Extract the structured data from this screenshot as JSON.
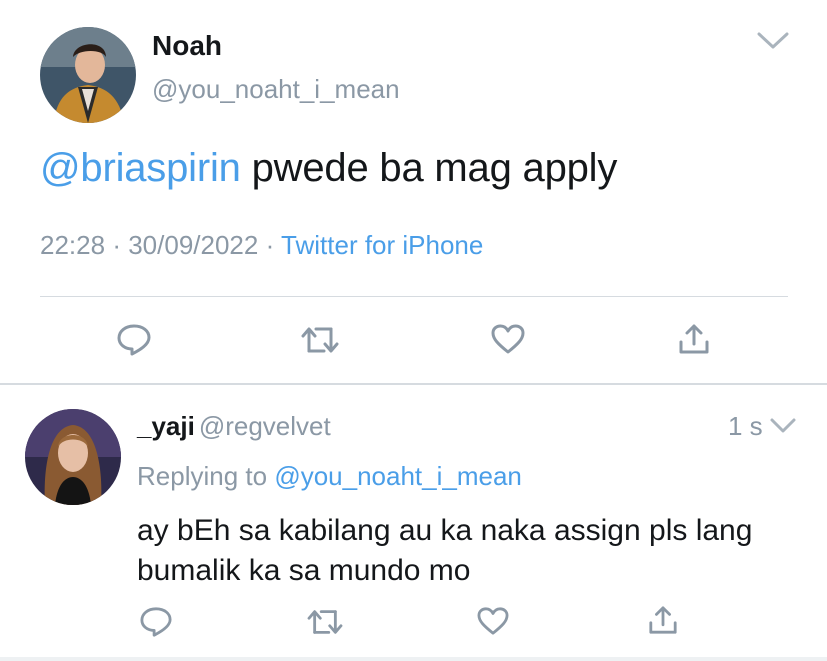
{
  "main_tweet": {
    "author_name": "Noah",
    "author_handle": "@you_noaht_i_mean",
    "mention": "@briaspirin",
    "text": " pwede ba mag apply",
    "time": "22:28",
    "dot": "·",
    "date": "30/09/2022",
    "source": "Twitter for iPhone"
  },
  "reply_tweet": {
    "author_name": "_yaji",
    "author_handle": "@regvelvet",
    "time_ago": "1 s",
    "replying_prefix": "Replying to ",
    "replying_to": "@you_noaht_i_mean",
    "text": "ay bEh sa kabilang au ka naka assign pls lang bumalik ka sa mundo mo"
  },
  "icons": {
    "reply": "reply-icon",
    "retweet": "retweet-icon",
    "like": "heart-icon",
    "share": "share-icon",
    "more": "chevron-down-icon"
  },
  "colors": {
    "link": "#4a9ee8",
    "secondary_text": "#8b98a5",
    "primary_text": "#14171a",
    "divider": "#d6dbe0"
  }
}
